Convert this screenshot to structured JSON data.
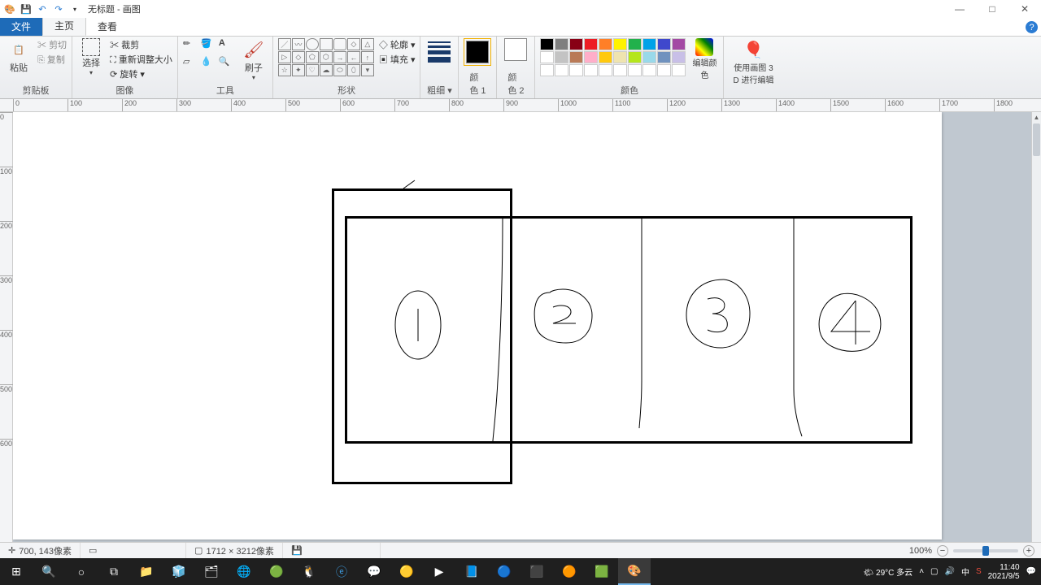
{
  "window": {
    "title": "无标题 - 画图",
    "min": "—",
    "max": "□",
    "close": "✕",
    "help": "?"
  },
  "tabs": {
    "file": "文件",
    "home": "主页",
    "view": "查看"
  },
  "ribbon": {
    "clipboard": {
      "paste": "粘贴",
      "cut": "剪切",
      "copy": "复制",
      "label": "剪贴板"
    },
    "image": {
      "select": "选择",
      "crop": "裁剪",
      "resize": "重新调整大小",
      "rotate": "旋转",
      "label": "图像"
    },
    "tools": {
      "brush": "刷子",
      "label": "工具"
    },
    "shapes": {
      "outline": "轮廓",
      "fill": "填充",
      "label": "形状"
    },
    "stroke": {
      "label": "粗细"
    },
    "color1": {
      "label1": "颜",
      "label2": "色 1"
    },
    "color2": {
      "label1": "颜",
      "label2": "色 2"
    },
    "colors": {
      "edit": "编辑颜色",
      "label": "颜色"
    },
    "paint3d": {
      "line1": "使用画图 3",
      "line2": "D 进行编辑"
    }
  },
  "ruler": {
    "h": [
      "0",
      "100",
      "200",
      "300",
      "400",
      "500",
      "600",
      "700",
      "800",
      "900",
      "1000",
      "1100",
      "1200",
      "1300",
      "1400",
      "1500",
      "1600",
      "1700",
      "1800"
    ],
    "v": [
      "0",
      "100",
      "200",
      "300",
      "400",
      "500",
      "600"
    ]
  },
  "status": {
    "coords_prefix": "✛",
    "coords": "700, 143像素",
    "size": "1712 × 3212像素",
    "zoom": "100%",
    "zoom_minus": "−",
    "zoom_plus": "+"
  },
  "taskbar": {
    "weather": "🌤 29°C 多云",
    "time": "11:40",
    "date": "2021/9/5"
  },
  "palette_row1": [
    "#000000",
    "#7f7f7f",
    "#880015",
    "#ed1c24",
    "#ff7f27",
    "#fff200",
    "#22b14c",
    "#00a2e8",
    "#3f48cc",
    "#a349a4"
  ],
  "palette_row2": [
    "#ffffff",
    "#c3c3c3",
    "#b97a57",
    "#ffaec9",
    "#ffc90e",
    "#efe4b0",
    "#b5e61d",
    "#99d9ea",
    "#7092be",
    "#c8bfe7"
  ],
  "palette_row3": [
    "#ffffff",
    "#ffffff",
    "#ffffff",
    "#ffffff",
    "#ffffff",
    "#ffffff",
    "#ffffff",
    "#ffffff",
    "#ffffff",
    "#ffffff"
  ]
}
